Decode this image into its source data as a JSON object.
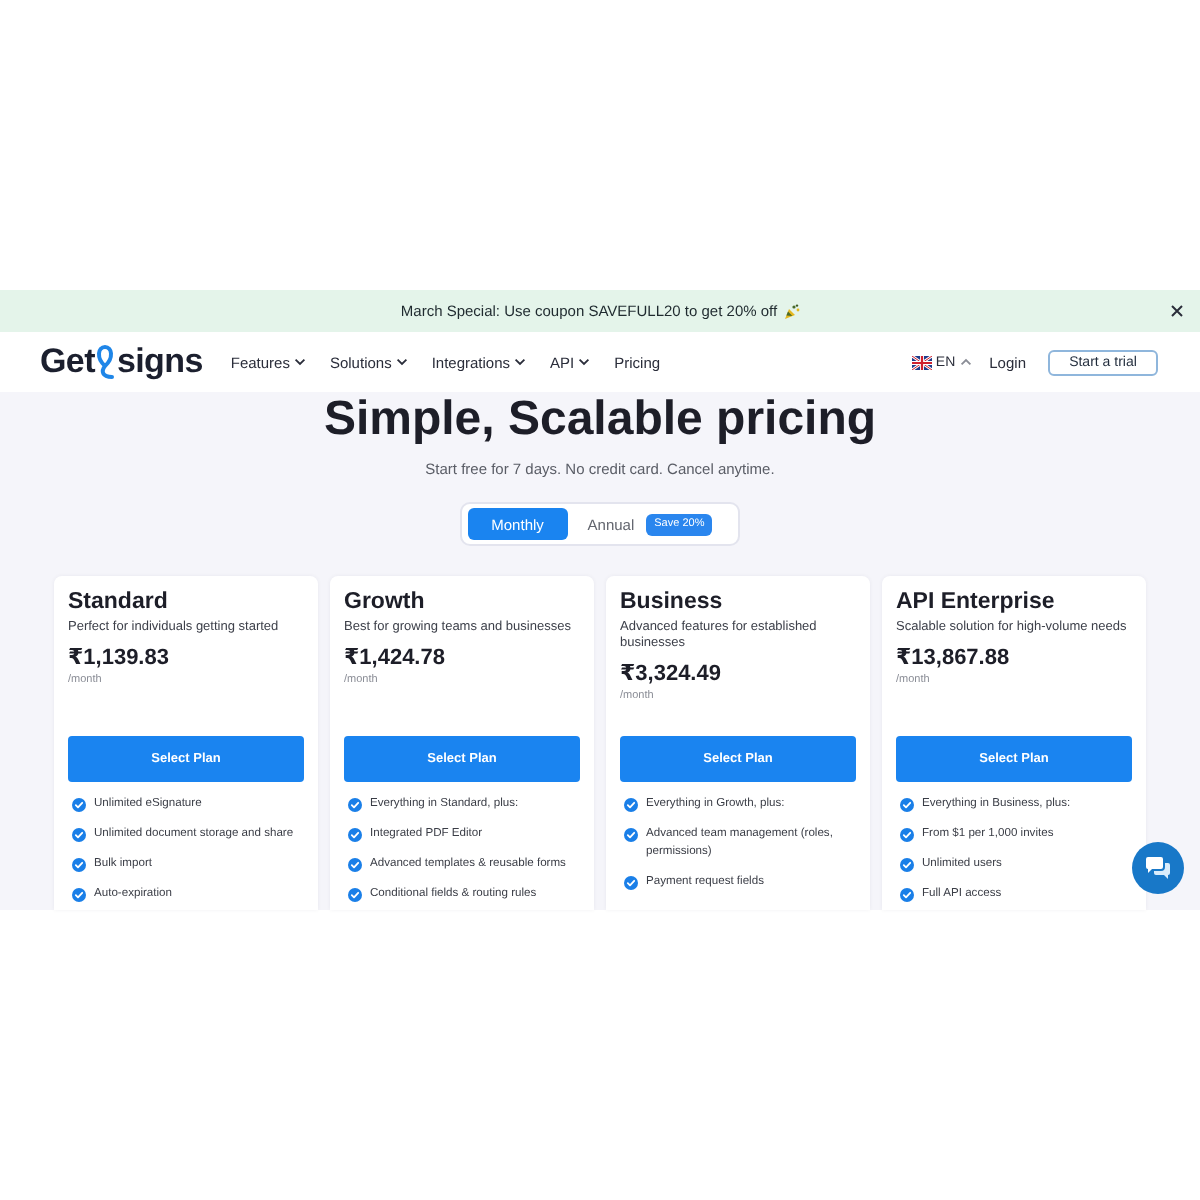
{
  "announcement": {
    "text": "March Special: Use coupon SAVEFULL20 to get 20% off"
  },
  "nav": {
    "logo": {
      "before": "Get",
      "after": "signs"
    },
    "menu": [
      {
        "label": "Features",
        "dropdown": true
      },
      {
        "label": "Solutions",
        "dropdown": true
      },
      {
        "label": "Integrations",
        "dropdown": true
      },
      {
        "label": "API",
        "dropdown": true
      },
      {
        "label": "Pricing",
        "dropdown": false
      }
    ],
    "language": "EN",
    "login": "Login",
    "cta": "Start a trial"
  },
  "hero": {
    "title": "Simple, Scalable pricing",
    "subtitle": "Start free for 7 days. No credit card. Cancel anytime."
  },
  "billing_toggle": [
    {
      "label": "Monthly",
      "selected": true
    },
    {
      "label": "Annual",
      "selected": false,
      "badge": "Save 20%"
    }
  ],
  "plans": [
    {
      "name": "Standard",
      "description": "Perfect for individuals getting started",
      "price": "₹1,139.83",
      "period": "/month",
      "button": "Select Plan",
      "features": [
        "Unlimited eSignature",
        "Unlimited document storage and share",
        "Bulk import",
        "Auto-expiration"
      ]
    },
    {
      "name": "Growth",
      "description": "Best for growing teams and businesses",
      "price": "₹1,424.78",
      "period": "/month",
      "button": "Select Plan",
      "features": [
        "Everything in Standard, plus:",
        "Integrated PDF Editor",
        "Advanced templates & reusable forms",
        "Conditional fields & routing rules"
      ]
    },
    {
      "name": "Business",
      "description": "Advanced features for established businesses",
      "price": "₹3,324.49",
      "period": "/month",
      "button": "Select Plan",
      "features": [
        "Everything in Growth, plus:",
        "Advanced team management (roles, permissions)",
        "Payment request fields"
      ]
    },
    {
      "name": "API Enterprise",
      "description": "Scalable solution for high-volume needs",
      "price": "₹13,867.88",
      "period": "/month",
      "button": "Select Plan",
      "features": [
        "Everything in Business, plus:",
        "From $1 per 1,000 invites",
        "Unlimited users",
        "Full API access"
      ]
    }
  ]
}
